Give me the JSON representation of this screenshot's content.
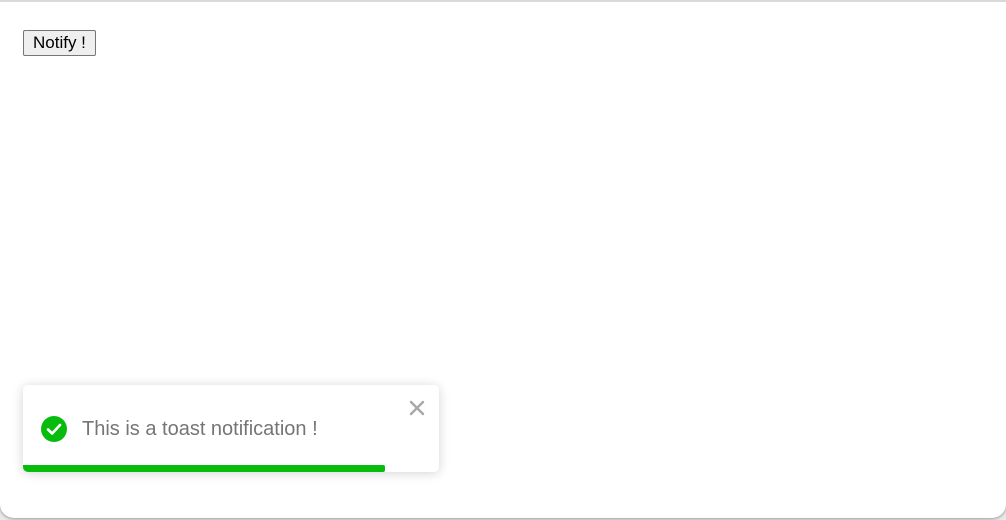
{
  "main": {
    "notify_button_label": "Notify !"
  },
  "toast": {
    "message": "This is a toast notification !",
    "type": "success",
    "icon": "check-circle-icon",
    "close_icon": "close-icon",
    "progress_remaining": 0.87,
    "accent_color": "#07bc0c",
    "text_color": "#757575"
  }
}
